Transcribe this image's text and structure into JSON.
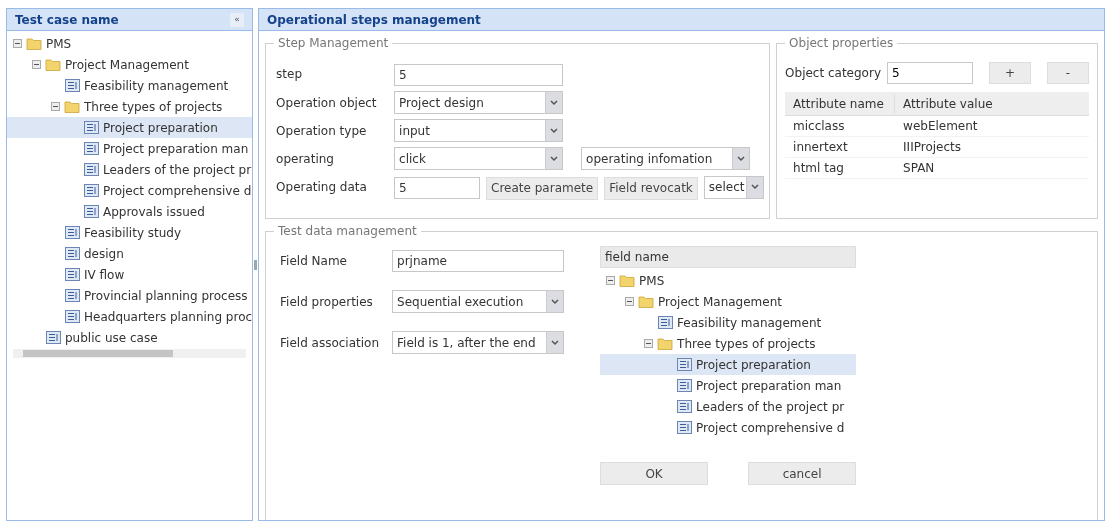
{
  "left_panel": {
    "title": "Test case name",
    "collapse_button": "«",
    "tree": [
      {
        "label": "PMS",
        "selected": false,
        "expanded": true,
        "children": [
          {
            "label": "Project Management",
            "selected": false,
            "expanded": true,
            "children": [
              {
                "label": "Feasibility management",
                "selected": false
              },
              {
                "label": "Three types of projects",
                "selected": false,
                "expanded": true,
                "children": [
                  {
                    "label": "Project preparation",
                    "selected": true
                  },
                  {
                    "label": "Project preparation man",
                    "selected": false
                  },
                  {
                    "label": "Leaders of the project pr",
                    "selected": false
                  },
                  {
                    "label": "Project comprehensive d",
                    "selected": false
                  },
                  {
                    "label": "Approvals issued",
                    "selected": false
                  }
                ]
              },
              {
                "label": "Feasibility study",
                "selected": false
              },
              {
                "label": "design",
                "selected": false
              },
              {
                "label": "IV flow",
                "selected": false
              },
              {
                "label": "Provincial planning process",
                "selected": false
              },
              {
                "label": "Headquarters planning proc",
                "selected": false
              }
            ]
          },
          {
            "label": "public use case",
            "selected": false
          }
        ]
      }
    ]
  },
  "main": {
    "title": "Operational steps management",
    "step_management": {
      "legend": "Step Management",
      "rows": [
        {
          "label": "step",
          "controls": [
            {
              "kind": "text",
              "value": "5"
            }
          ]
        },
        {
          "label": "Operation object",
          "controls": [
            {
              "kind": "select",
              "value": "Project design"
            }
          ]
        },
        {
          "label": "Operation type",
          "controls": [
            {
              "kind": "select",
              "value": "input"
            }
          ]
        },
        {
          "label": "operating",
          "controls": [
            {
              "kind": "select",
              "value": "click"
            },
            {
              "kind": "select",
              "value": "operating infomation"
            }
          ]
        },
        {
          "label": "Operating data",
          "controls": [
            {
              "kind": "text",
              "value": "5"
            },
            {
              "kind": "button",
              "label": "Create paramete"
            },
            {
              "kind": "button",
              "label": "Field revocatk"
            },
            {
              "kind": "select",
              "value": "select"
            }
          ]
        }
      ]
    },
    "object_properties": {
      "legend": "Object properties",
      "category_label": "Object category",
      "category_value": "5",
      "buttons": [
        "+",
        "-"
      ],
      "table": {
        "columns": [
          "Attribute name",
          "Attribute value"
        ],
        "rows": [
          [
            "micclass",
            "webElement"
          ],
          [
            "innertext",
            "IIIProjects"
          ],
          [
            "html tag",
            "SPAN"
          ]
        ]
      }
    },
    "test_data": {
      "legend": "Test data management",
      "rows": [
        {
          "label": "Field Name",
          "control": {
            "kind": "text",
            "value": "prjname"
          }
        },
        {
          "label": "Field properties",
          "control": {
            "kind": "select",
            "value": "Sequential execution"
          }
        },
        {
          "label": "Field association",
          "control": {
            "kind": "select",
            "value": "Field is 1, after the end"
          }
        }
      ],
      "field_tree": {
        "header": "field name",
        "tree": [
          {
            "label": "PMS",
            "selected": false,
            "expanded": true,
            "children": [
              {
                "label": "Project Management",
                "selected": false,
                "expanded": true,
                "children": [
                  {
                    "label": "Feasibility management",
                    "selected": false
                  },
                  {
                    "label": "Three types of projects",
                    "selected": false,
                    "expanded": true,
                    "children": [
                      {
                        "label": "Project preparation",
                        "selected": true
                      },
                      {
                        "label": "Project preparation man",
                        "selected": false
                      },
                      {
                        "label": "Leaders of the project pr",
                        "selected": false
                      },
                      {
                        "label": "Project comprehensive d",
                        "selected": false
                      }
                    ]
                  }
                ]
              }
            ]
          }
        ],
        "buttons": [
          "OK",
          "cancel"
        ]
      }
    }
  }
}
